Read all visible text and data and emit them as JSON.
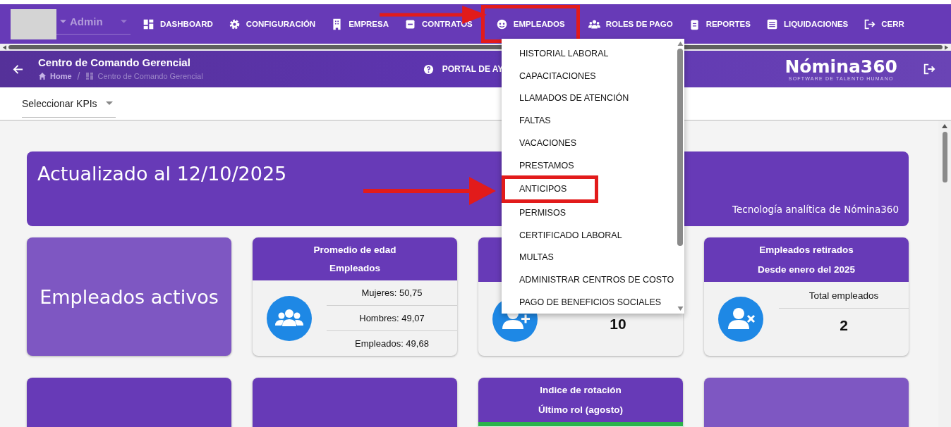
{
  "user": {
    "name": "Admin"
  },
  "nav": [
    {
      "label": "DASHBOARD",
      "highlighted": false
    },
    {
      "label": "CONFIGURACIÓN",
      "highlighted": false
    },
    {
      "label": "EMPRESA",
      "highlighted": false
    },
    {
      "label": "CONTRATOS",
      "highlighted": false
    },
    {
      "label": "EMPLEADOS",
      "highlighted": true
    },
    {
      "label": "ROLES DE PAGO",
      "highlighted": false
    },
    {
      "label": "REPORTES",
      "highlighted": false
    },
    {
      "label": "LIQUIDACIONES",
      "highlighted": false
    },
    {
      "label": "CERR",
      "highlighted": false
    }
  ],
  "header": {
    "title": "Centro de Comando Gerencial",
    "breadcrumb": [
      {
        "label": "Home"
      },
      {
        "label": "Centro de Comando Gerencial"
      }
    ],
    "separator": "/",
    "help": "PORTAL DE AY",
    "logo": "Nómina360",
    "tagline": "SOFTWARE DE TALENTO HUMANO"
  },
  "kpi_select": {
    "placeholder": "Seleccionar KPIs"
  },
  "banner": {
    "title": "Actualizado al 12/10/2025",
    "subtitle": "Tecnología analítica de Nómina360"
  },
  "cards": [
    {
      "kind": "big",
      "title": "Empleados activos"
    },
    {
      "kind": "stats",
      "header": [
        "Promedio de edad",
        "Empleados"
      ],
      "rows": [
        "Mujeres: 50,75",
        "Hombres: 49,07",
        "Empleados: 49,68"
      ]
    },
    {
      "kind": "count",
      "value": "10"
    },
    {
      "kind": "count",
      "header": [
        "Empleados retirados",
        "Desde enero del 2025"
      ],
      "label": "Total empleados",
      "value": "2"
    }
  ],
  "cards_row2": [
    {
      "kind": "dark"
    },
    {
      "kind": "dark"
    },
    {
      "kind": "header",
      "header": [
        "Indice de rotación",
        "Último rol (agosto)"
      ]
    },
    {
      "kind": "light"
    }
  ],
  "menu": {
    "items": [
      {
        "label": "HISTORIAL LABORAL",
        "highlighted": false
      },
      {
        "label": "CAPACITACIONES",
        "highlighted": false
      },
      {
        "label": "LLAMADOS DE ATENCIÓN",
        "highlighted": false
      },
      {
        "label": "FALTAS",
        "highlighted": false
      },
      {
        "label": "VACACIONES",
        "highlighted": false
      },
      {
        "label": "PRESTAMOS",
        "highlighted": false
      },
      {
        "label": "ANTICIPOS",
        "highlighted": true
      },
      {
        "label": "PERMISOS",
        "highlighted": false
      },
      {
        "label": "CERTIFICADO LABORAL",
        "highlighted": false
      },
      {
        "label": "MULTAS",
        "highlighted": false
      },
      {
        "label": "ADMINISTRAR CENTROS DE COSTO",
        "highlighted": false
      },
      {
        "label": "PAGO DE BENEFICIOS SOCIALES",
        "highlighted": false
      }
    ]
  }
}
